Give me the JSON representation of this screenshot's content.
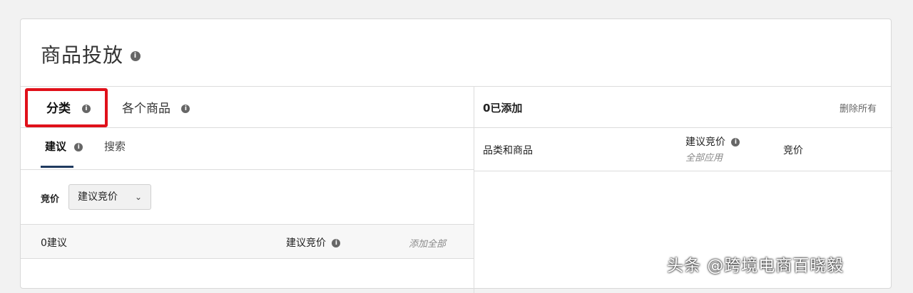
{
  "header": {
    "title": "商品投放"
  },
  "tabs": [
    {
      "label": "分类",
      "active": true
    },
    {
      "label": "各个商品",
      "active": false
    }
  ],
  "subtabs": [
    {
      "label": "建议",
      "active": true
    },
    {
      "label": "搜索",
      "active": false
    }
  ],
  "bid": {
    "label": "竞价",
    "select_value": "建议竞价"
  },
  "suggestions": {
    "count_label": "0建议",
    "col_label": "建议竞价",
    "add_all": "添加全部"
  },
  "added": {
    "count_label": "0已添加",
    "remove_all": "删除所有",
    "columns": {
      "category": "品类和商品",
      "suggested_bid": "建议竞价",
      "apply_all": "全部应用",
      "bid": "竞价"
    }
  },
  "watermark": "头条 @跨境电商百晓毅",
  "colors": {
    "highlight": "#e0101a",
    "underline": "#1f3a5f"
  },
  "icons": [
    "info-icon",
    "chevron-down-icon"
  ]
}
